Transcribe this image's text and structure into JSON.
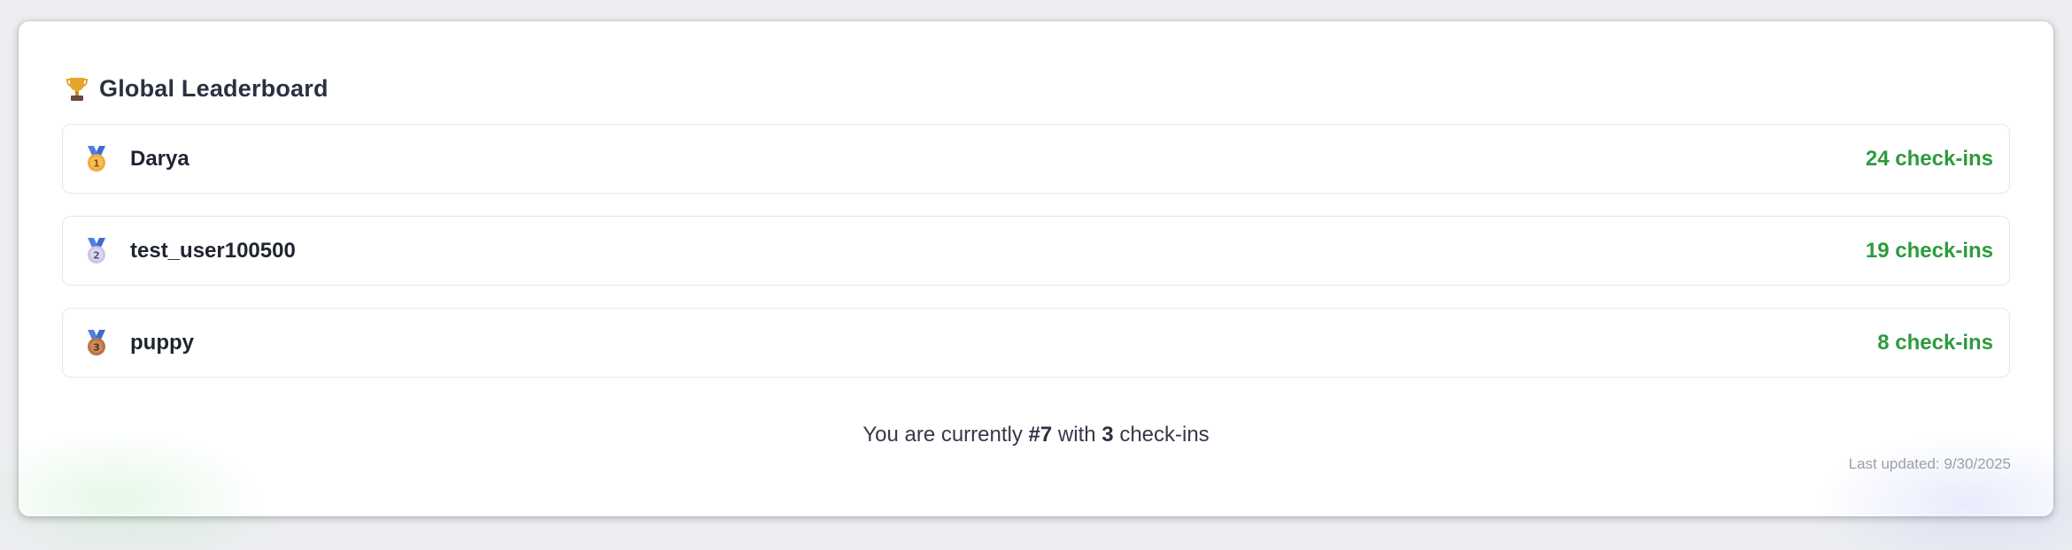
{
  "leaderboard": {
    "title": "Global Leaderboard",
    "title_icon": "trophy-icon",
    "entries": [
      {
        "rank": "1",
        "medal": "gold-medal-icon",
        "name": "Darya",
        "count_label": "24 check-ins"
      },
      {
        "rank": "2",
        "medal": "silver-medal-icon",
        "name": "test_user100500",
        "count_label": "19 check-ins"
      },
      {
        "rank": "3",
        "medal": "bronze-medal-icon",
        "name": "puppy",
        "count_label": "8 check-ins"
      }
    ],
    "current_user": {
      "prefix": "You are currently",
      "rank": "#7",
      "middle": "with",
      "count": "3",
      "suffix": "check-ins"
    },
    "last_updated": "Last updated: 9/30/2025"
  },
  "colors": {
    "count_green": "#2e9b3e",
    "gold": "#f2a93b",
    "silver": "#c9c4e8",
    "bronze": "#b8734a",
    "ribbon": "#4f7fe0"
  }
}
